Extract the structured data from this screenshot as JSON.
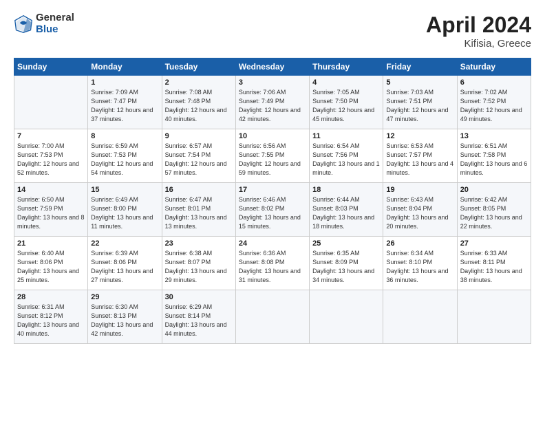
{
  "header": {
    "logo_general": "General",
    "logo_blue": "Blue",
    "title": "April 2024",
    "subtitle": "Kifisia, Greece"
  },
  "columns": [
    "Sunday",
    "Monday",
    "Tuesday",
    "Wednesday",
    "Thursday",
    "Friday",
    "Saturday"
  ],
  "weeks": [
    [
      {
        "day": "",
        "sunrise": "",
        "sunset": "",
        "daylight": ""
      },
      {
        "day": "1",
        "sunrise": "Sunrise: 7:09 AM",
        "sunset": "Sunset: 7:47 PM",
        "daylight": "Daylight: 12 hours and 37 minutes."
      },
      {
        "day": "2",
        "sunrise": "Sunrise: 7:08 AM",
        "sunset": "Sunset: 7:48 PM",
        "daylight": "Daylight: 12 hours and 40 minutes."
      },
      {
        "day": "3",
        "sunrise": "Sunrise: 7:06 AM",
        "sunset": "Sunset: 7:49 PM",
        "daylight": "Daylight: 12 hours and 42 minutes."
      },
      {
        "day": "4",
        "sunrise": "Sunrise: 7:05 AM",
        "sunset": "Sunset: 7:50 PM",
        "daylight": "Daylight: 12 hours and 45 minutes."
      },
      {
        "day": "5",
        "sunrise": "Sunrise: 7:03 AM",
        "sunset": "Sunset: 7:51 PM",
        "daylight": "Daylight: 12 hours and 47 minutes."
      },
      {
        "day": "6",
        "sunrise": "Sunrise: 7:02 AM",
        "sunset": "Sunset: 7:52 PM",
        "daylight": "Daylight: 12 hours and 49 minutes."
      }
    ],
    [
      {
        "day": "7",
        "sunrise": "Sunrise: 7:00 AM",
        "sunset": "Sunset: 7:53 PM",
        "daylight": "Daylight: 12 hours and 52 minutes."
      },
      {
        "day": "8",
        "sunrise": "Sunrise: 6:59 AM",
        "sunset": "Sunset: 7:53 PM",
        "daylight": "Daylight: 12 hours and 54 minutes."
      },
      {
        "day": "9",
        "sunrise": "Sunrise: 6:57 AM",
        "sunset": "Sunset: 7:54 PM",
        "daylight": "Daylight: 12 hours and 57 minutes."
      },
      {
        "day": "10",
        "sunrise": "Sunrise: 6:56 AM",
        "sunset": "Sunset: 7:55 PM",
        "daylight": "Daylight: 12 hours and 59 minutes."
      },
      {
        "day": "11",
        "sunrise": "Sunrise: 6:54 AM",
        "sunset": "Sunset: 7:56 PM",
        "daylight": "Daylight: 13 hours and 1 minute."
      },
      {
        "day": "12",
        "sunrise": "Sunrise: 6:53 AM",
        "sunset": "Sunset: 7:57 PM",
        "daylight": "Daylight: 13 hours and 4 minutes."
      },
      {
        "day": "13",
        "sunrise": "Sunrise: 6:51 AM",
        "sunset": "Sunset: 7:58 PM",
        "daylight": "Daylight: 13 hours and 6 minutes."
      }
    ],
    [
      {
        "day": "14",
        "sunrise": "Sunrise: 6:50 AM",
        "sunset": "Sunset: 7:59 PM",
        "daylight": "Daylight: 13 hours and 8 minutes."
      },
      {
        "day": "15",
        "sunrise": "Sunrise: 6:49 AM",
        "sunset": "Sunset: 8:00 PM",
        "daylight": "Daylight: 13 hours and 11 minutes."
      },
      {
        "day": "16",
        "sunrise": "Sunrise: 6:47 AM",
        "sunset": "Sunset: 8:01 PM",
        "daylight": "Daylight: 13 hours and 13 minutes."
      },
      {
        "day": "17",
        "sunrise": "Sunrise: 6:46 AM",
        "sunset": "Sunset: 8:02 PM",
        "daylight": "Daylight: 13 hours and 15 minutes."
      },
      {
        "day": "18",
        "sunrise": "Sunrise: 6:44 AM",
        "sunset": "Sunset: 8:03 PM",
        "daylight": "Daylight: 13 hours and 18 minutes."
      },
      {
        "day": "19",
        "sunrise": "Sunrise: 6:43 AM",
        "sunset": "Sunset: 8:04 PM",
        "daylight": "Daylight: 13 hours and 20 minutes."
      },
      {
        "day": "20",
        "sunrise": "Sunrise: 6:42 AM",
        "sunset": "Sunset: 8:05 PM",
        "daylight": "Daylight: 13 hours and 22 minutes."
      }
    ],
    [
      {
        "day": "21",
        "sunrise": "Sunrise: 6:40 AM",
        "sunset": "Sunset: 8:06 PM",
        "daylight": "Daylight: 13 hours and 25 minutes."
      },
      {
        "day": "22",
        "sunrise": "Sunrise: 6:39 AM",
        "sunset": "Sunset: 8:06 PM",
        "daylight": "Daylight: 13 hours and 27 minutes."
      },
      {
        "day": "23",
        "sunrise": "Sunrise: 6:38 AM",
        "sunset": "Sunset: 8:07 PM",
        "daylight": "Daylight: 13 hours and 29 minutes."
      },
      {
        "day": "24",
        "sunrise": "Sunrise: 6:36 AM",
        "sunset": "Sunset: 8:08 PM",
        "daylight": "Daylight: 13 hours and 31 minutes."
      },
      {
        "day": "25",
        "sunrise": "Sunrise: 6:35 AM",
        "sunset": "Sunset: 8:09 PM",
        "daylight": "Daylight: 13 hours and 34 minutes."
      },
      {
        "day": "26",
        "sunrise": "Sunrise: 6:34 AM",
        "sunset": "Sunset: 8:10 PM",
        "daylight": "Daylight: 13 hours and 36 minutes."
      },
      {
        "day": "27",
        "sunrise": "Sunrise: 6:33 AM",
        "sunset": "Sunset: 8:11 PM",
        "daylight": "Daylight: 13 hours and 38 minutes."
      }
    ],
    [
      {
        "day": "28",
        "sunrise": "Sunrise: 6:31 AM",
        "sunset": "Sunset: 8:12 PM",
        "daylight": "Daylight: 13 hours and 40 minutes."
      },
      {
        "day": "29",
        "sunrise": "Sunrise: 6:30 AM",
        "sunset": "Sunset: 8:13 PM",
        "daylight": "Daylight: 13 hours and 42 minutes."
      },
      {
        "day": "30",
        "sunrise": "Sunrise: 6:29 AM",
        "sunset": "Sunset: 8:14 PM",
        "daylight": "Daylight: 13 hours and 44 minutes."
      },
      {
        "day": "",
        "sunrise": "",
        "sunset": "",
        "daylight": ""
      },
      {
        "day": "",
        "sunrise": "",
        "sunset": "",
        "daylight": ""
      },
      {
        "day": "",
        "sunrise": "",
        "sunset": "",
        "daylight": ""
      },
      {
        "day": "",
        "sunrise": "",
        "sunset": "",
        "daylight": ""
      }
    ]
  ]
}
